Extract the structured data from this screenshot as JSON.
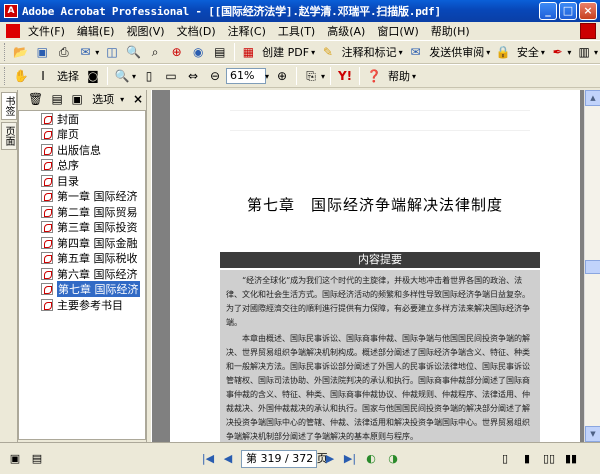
{
  "window": {
    "title": "Adobe Acrobat Professional - [[国际经济法学].赵学清.邓瑞平.扫描版.pdf]",
    "app_icon": "pdf-icon"
  },
  "menubar": {
    "items": [
      "文件(F)",
      "编辑(E)",
      "视图(V)",
      "文档(D)",
      "注释(C)",
      "工具(T)",
      "高级(A)",
      "窗口(W)",
      "帮助(H)"
    ]
  },
  "toolbar1": {
    "create_pdf": "创建 PDF",
    "comment": "注释和标记",
    "send_review": "发送供审阅",
    "secure": "安全",
    "sign": ""
  },
  "toolbar2": {
    "select": "选择",
    "zoom_value": "61%",
    "help": "帮助"
  },
  "left_tabs": [
    "书签",
    "页面"
  ],
  "bookmarks": {
    "options_label": "选项",
    "items": [
      "封面",
      "扉页",
      "出版信息",
      "总序",
      "目录",
      "第一章 国际经济",
      "第二章 国际贸易",
      "第三章 国际投资",
      "第四章 国际金融",
      "第五章 国际税收",
      "第六章 国际经济",
      "第七章 国际经济",
      "主要参考书目"
    ],
    "selected_index": 11
  },
  "document": {
    "chapter_title": "第七章　国际经济争端解决法律制度",
    "abstract_heading": "内容提要",
    "abstract_paragraphs": [
      "“经济全球化”成为我们这个时代的主旋律，并极大地冲击着世界各国的政治、法律、文化和社会生活方式。国际经济活动的频繁和多样性导致国际经济争端日益复杂。为了对國際經濟交往的順利進行提供有力保障，有必要建立多样方法来解决国际经济争端。",
      "本章由概述、国际民事诉讼、国际商事仲裁、国际争端与他国国民间投资争端的解决、世界贸易组织争端解决机制构成。概述部分阐述了国际经济争端含义、特征、种类和一般解决方法。国际民事诉讼部分阐述了外国人的民事诉讼法律地位、国际民事诉讼管辖权、国际司法协助、外国法院判决的承认和执行。国际商事仲裁部分阐述了国际商事仲裁的含义、特征、种类、国际商事仲裁协议、仲裁规则、仲裁程序、法律适用、仲裁裁决、外国仲裁裁决的承认和执行。国家与他国国民间投资争端的解决部分阐述了解决投资争端国际中心的管辖、仲裁、法律适用和解决投资争端国际中心。世界贸易组织争端解决机制部分阐述了争端解决的基本原则与程序。"
    ]
  },
  "statusbar": {
    "page_indicator": "第 319 / 372 页"
  }
}
